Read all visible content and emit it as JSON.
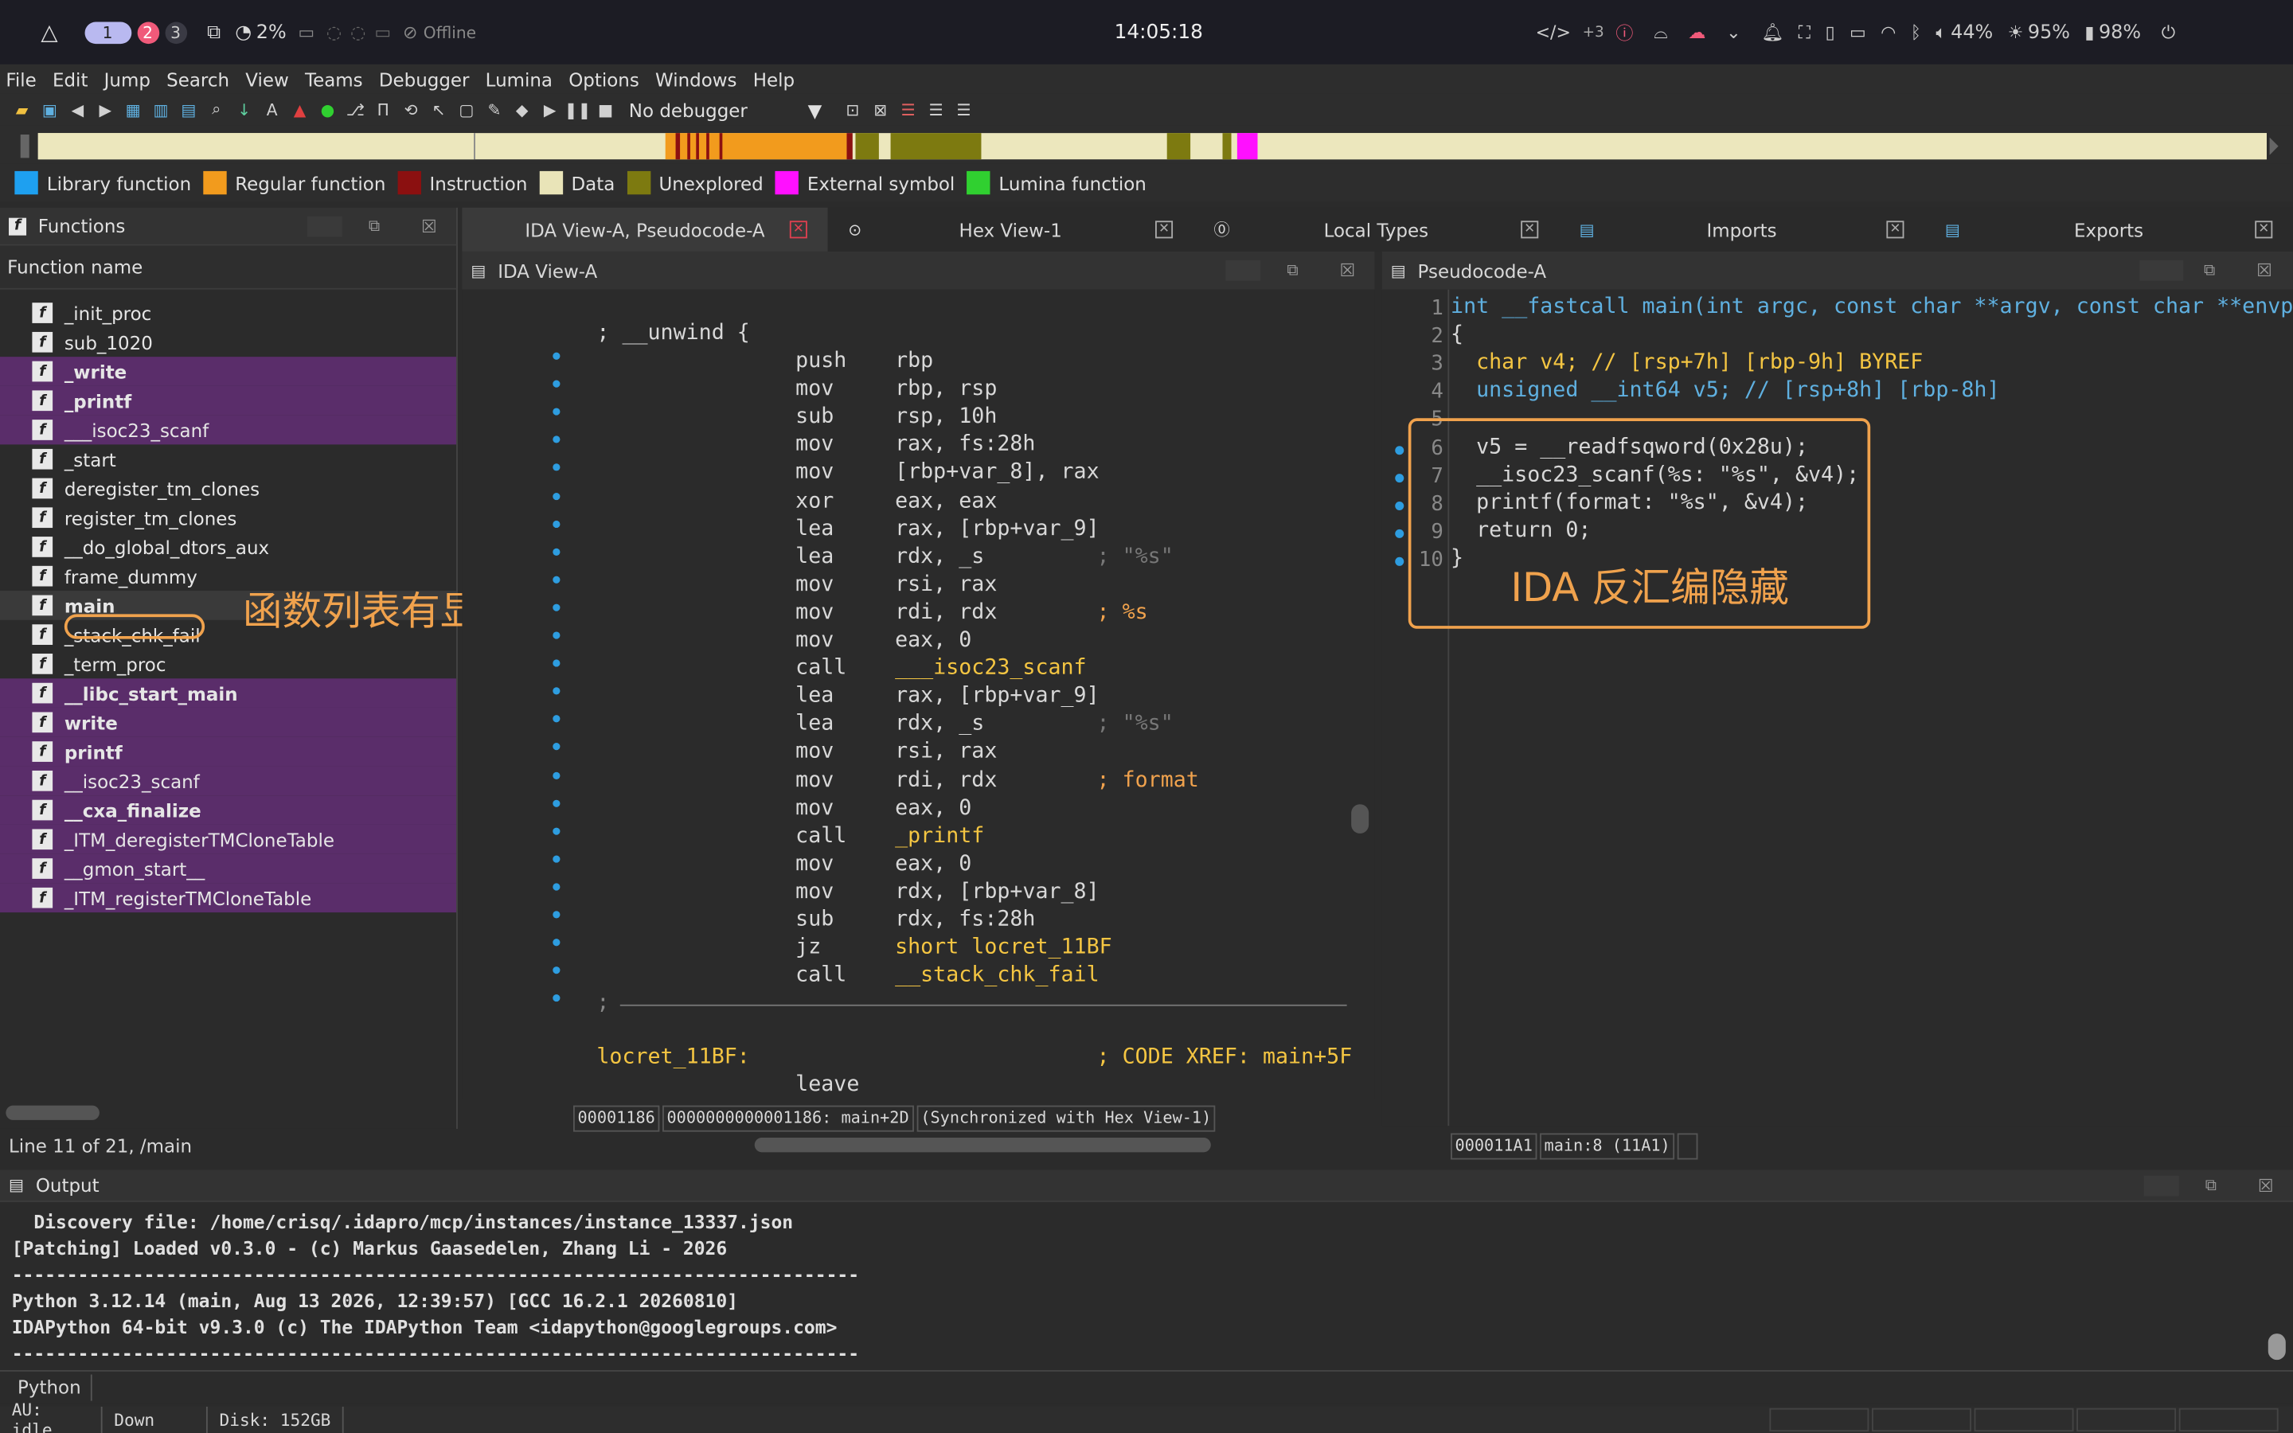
{
  "topbar": {
    "workspaces": [
      "1",
      "2",
      "3"
    ],
    "cpu": "2%",
    "network": "Offline",
    "clock": "14:05:18",
    "net_label": "+3",
    "volume": "44%",
    "brightness": "95%",
    "battery": "98%"
  },
  "menus": [
    "File",
    "Edit",
    "Jump",
    "Search",
    "View",
    "Teams",
    "Debugger",
    "Lumina",
    "Options",
    "Windows",
    "Help"
  ],
  "toolbar": {
    "debugger_select": "No debugger"
  },
  "legend": [
    {
      "label": "Library function",
      "color": "#1ea0f0"
    },
    {
      "label": "Regular function",
      "color": "#f29b1d"
    },
    {
      "label": "Instruction",
      "color": "#8b1010"
    },
    {
      "label": "Data",
      "color": "#e9e4b8"
    },
    {
      "label": "Unexplored",
      "color": "#7d7a10"
    },
    {
      "label": "External symbol",
      "color": "#ff10ff"
    },
    {
      "label": "Lumina function",
      "color": "#30d030"
    }
  ],
  "functions": {
    "title": "Functions",
    "column": "Function name",
    "status": "Line 11 of 21, /main",
    "items": [
      {
        "name": "_init_proc",
        "lib": false,
        "bold": false
      },
      {
        "name": "sub_1020",
        "lib": false,
        "bold": false
      },
      {
        "name": "_write",
        "lib": true,
        "bold": true
      },
      {
        "name": "_printf",
        "lib": true,
        "bold": true
      },
      {
        "name": "___isoc23_scanf",
        "lib": true,
        "bold": false
      },
      {
        "name": "_start",
        "lib": false,
        "bold": false
      },
      {
        "name": "deregister_tm_clones",
        "lib": false,
        "bold": false
      },
      {
        "name": "register_tm_clones",
        "lib": false,
        "bold": false
      },
      {
        "name": "__do_global_dtors_aux",
        "lib": false,
        "bold": false
      },
      {
        "name": "frame_dummy",
        "lib": false,
        "bold": false
      },
      {
        "name": "main",
        "lib": false,
        "bold": true
      },
      {
        "name": "_stack_chk_fail",
        "lib": false,
        "bold": false
      },
      {
        "name": "_term_proc",
        "lib": false,
        "bold": false
      },
      {
        "name": "__libc_start_main",
        "lib": true,
        "bold": true
      },
      {
        "name": "write",
        "lib": true,
        "bold": true
      },
      {
        "name": "printf",
        "lib": true,
        "bold": true
      },
      {
        "name": "__isoc23_scanf",
        "lib": true,
        "bold": false
      },
      {
        "name": "__cxa_finalize",
        "lib": true,
        "bold": true
      },
      {
        "name": "_ITM_deregisterTMCloneTable",
        "lib": true,
        "bold": false
      },
      {
        "name": "__gmon_start__",
        "lib": true,
        "bold": false
      },
      {
        "name": "_ITM_registerTMCloneTable",
        "lib": true,
        "bold": false
      }
    ]
  },
  "annotations": {
    "left": "函数列表有显示",
    "right": "IDA 反汇编隐藏"
  },
  "tabs": [
    "IDA View-A, Pseudocode-A",
    "Hex View-1",
    "Local Types",
    "Imports",
    "Exports"
  ],
  "idaview": {
    "title": "IDA View-A",
    "unwind": "; __unwind {",
    "semicolon": ";",
    "label": "locret_11BF:",
    "label_comment": "; CODE XREF: main+5F",
    "leave": "leave",
    "footer": [
      "00001186",
      "0000000000001186: main+2D",
      "(Synchronized with Hex View-1)"
    ],
    "lines": [
      {
        "m": "push",
        "o": "rbp",
        "c": ""
      },
      {
        "m": "mov",
        "o": "rbp, rsp",
        "c": ""
      },
      {
        "m": "sub",
        "o": "rsp, 10h",
        "c": ""
      },
      {
        "m": "mov",
        "o": "rax, fs:28h",
        "c": ""
      },
      {
        "m": "mov",
        "o": "[rbp+var_8], rax",
        "c": ""
      },
      {
        "m": "xor",
        "o": "eax, eax",
        "c": ""
      },
      {
        "m": "lea",
        "o": "rax, [rbp+var_9]",
        "c": ""
      },
      {
        "m": "lea",
        "o": "rdx, _s",
        "c": "; \"%s\""
      },
      {
        "m": "mov",
        "o": "rsi, rax",
        "c": ""
      },
      {
        "m": "mov",
        "o": "rdi, rdx",
        "c": "; %s"
      },
      {
        "m": "mov",
        "o": "eax, 0",
        "c": ""
      },
      {
        "m": "call",
        "o": "___isoc23_scanf",
        "c": ""
      },
      {
        "m": "lea",
        "o": "rax, [rbp+var_9]",
        "c": ""
      },
      {
        "m": "lea",
        "o": "rdx, _s",
        "c": "; \"%s\""
      },
      {
        "m": "mov",
        "o": "rsi, rax",
        "c": ""
      },
      {
        "m": "mov",
        "o": "rdi, rdx",
        "c": "; format"
      },
      {
        "m": "mov",
        "o": "eax, 0",
        "c": ""
      },
      {
        "m": "call",
        "o": "_printf",
        "c": ""
      },
      {
        "m": "mov",
        "o": "eax, 0",
        "c": ""
      },
      {
        "m": "mov",
        "o": "rdx, [rbp+var_8]",
        "c": ""
      },
      {
        "m": "sub",
        "o": "rdx, fs:28h",
        "c": ""
      },
      {
        "m": "jz",
        "o": "short locret_11BF",
        "c": ""
      },
      {
        "m": "call",
        "o": "__stack_chk_fail",
        "c": ""
      }
    ]
  },
  "pseudo": {
    "title": "Pseudocode-A",
    "footer": [
      "000011A1",
      "main:8 (11A1)"
    ],
    "lines": [
      "int __fastcall main(int argc, const char **argv, const char **envp)",
      "{",
      "  char v4; // [rsp+7h] [rbp-9h] BYREF",
      "  unsigned __int64 v5; // [rsp+8h] [rbp-8h]",
      "",
      "  v5 = __readfsqword(0x28u);",
      "  __isoc23_scanf(%s: \"%s\", &v4);",
      "  printf(format: \"%s\", &v4);",
      "  return 0;",
      "}"
    ]
  },
  "output": {
    "title": "Output",
    "lines": [
      "  Discovery file: /home/crisq/.idapro/mcp/instances/instance_13337.json",
      "[Patching] Loaded v0.3.0 - (c) Markus Gaasedelen, Zhang Li - 2026",
      "-----------------------------------------------------------------------------",
      "Python 3.12.14 (main, Aug 13 2026, 12:39:57) [GCC 16.2.1 20260810]",
      "IDAPython 64-bit v9.3.0 (c) The IDAPython Team <idapython@googlegroups.com>",
      "-----------------------------------------------------------------------------"
    ],
    "lang": "Python"
  },
  "statusbar": [
    "AU:  idle",
    "Down",
    "Disk: 152GB"
  ]
}
